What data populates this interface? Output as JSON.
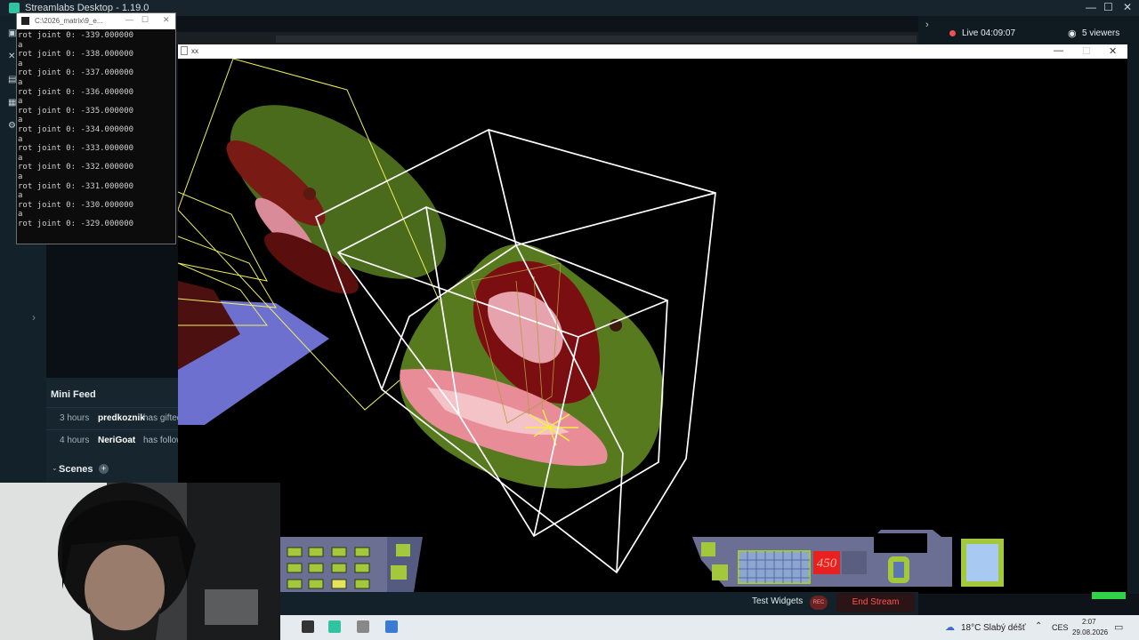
{
  "streamlabs": {
    "title": "Streamlabs Desktop - 1.19.0",
    "minimize_glyph": "—",
    "maximize_glyph": "☐",
    "close_glyph": "✕",
    "live_label": "Live 04:09:07",
    "viewers_label": "5 viewers",
    "minifeed": {
      "title": "Mini Feed",
      "items": [
        {
          "time": "3 hours",
          "user": "predkoznik",
          "action": "has gifted"
        },
        {
          "time": "4 hours",
          "user": "NeriGoat",
          "action": "has followed"
        }
      ]
    },
    "scenes_label": "Scenes",
    "test_widgets_label": "Test Widgets",
    "rec_label": "REC",
    "end_stream_label": "End Stream",
    "colors": {
      "accent": "#31c3a2",
      "live": "#f0504f",
      "end_stream": "#ff5552"
    }
  },
  "console": {
    "title": "C:\\2026_matrix\\9_e...",
    "lines": [
      "rot joint 0: -339.000000",
      "a",
      "rot joint 0: -338.000000",
      "a",
      "rot joint 0: -337.000000",
      "a",
      "rot joint 0: -336.000000",
      "a",
      "rot joint 0: -335.000000",
      "a",
      "rot joint 0: -334.000000",
      "a",
      "rot joint 0: -333.000000",
      "a",
      "rot joint 0: -332.000000",
      "a",
      "rot joint 0: -331.000000",
      "a",
      "rot joint 0: -330.000000",
      "a",
      "rot joint 0: -329.000000"
    ]
  },
  "viewport": {
    "window_title": "xx",
    "hud_score": "450"
  },
  "taskbar": {
    "weather_temp": "18°C",
    "weather_desc": "Slabý déšť",
    "language": "CES",
    "time": "2:07",
    "date": "29.08.2026"
  }
}
